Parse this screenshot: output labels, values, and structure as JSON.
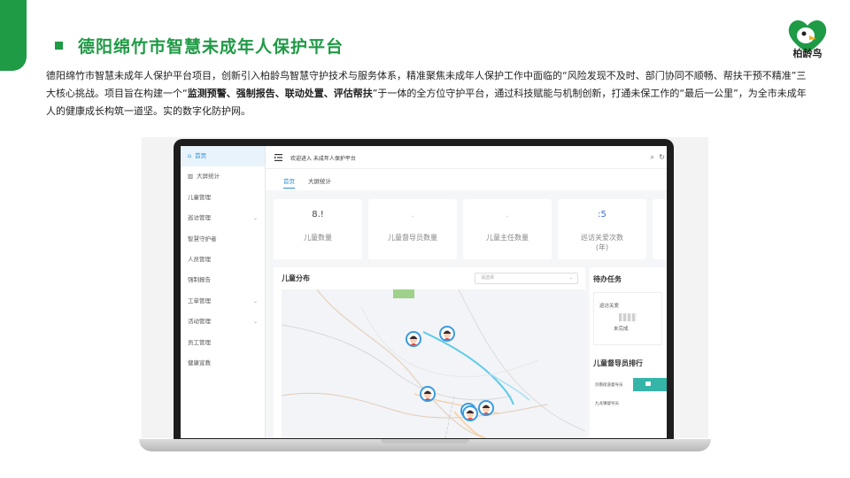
{
  "slide": {
    "title": "德阳绵竹市智慧未成年人保护平台",
    "logo_text": "柏龄鸟",
    "intro_part1": "德阳绵竹市智慧未成年人保护平台项目，创新引入柏龄鸟智慧守护技术与服务体系，精准聚焦未成年人保护工作中面临的“风险发现不及时、部门协同不顺畅、帮扶干预不精准”三大核心挑战。项目旨在构建一个“",
    "intro_bold": "监测预警、强制报告、联动处置、评估帮扶",
    "intro_part2": "”于一体的全方位守护平台，通过科技赋能与机制创新，打通未保工作的“最后一公里”，为全市未成年人的健康成长构筑一道坚。实的数字化防护网。"
  },
  "app": {
    "sidebar": [
      {
        "label": "首页",
        "icon": "home-icon",
        "active": true,
        "chevron": false
      },
      {
        "label": "大屏统计",
        "icon": "chart-icon",
        "active": false,
        "chevron": false
      },
      {
        "label": "儿童管理",
        "active": false,
        "chevron": false
      },
      {
        "label": "巡访管理",
        "active": false,
        "chevron": true
      },
      {
        "label": "智慧守护者",
        "active": false,
        "chevron": false
      },
      {
        "label": "人员管理",
        "active": false,
        "chevron": false
      },
      {
        "label": "强制报告",
        "active": false,
        "chevron": false
      },
      {
        "label": "工单管理",
        "active": false,
        "chevron": true
      },
      {
        "label": "活动管理",
        "active": false,
        "chevron": true
      },
      {
        "label": "员工管理",
        "active": false,
        "chevron": false
      },
      {
        "label": "健康宣教",
        "active": false,
        "chevron": false
      }
    ],
    "topbar_title": "欢迎进入 未成年人保护平台",
    "tabs": [
      "首页",
      "大屏统计"
    ],
    "stats": [
      {
        "value": "8.!",
        "label": "儿童数量",
        "value_color": "#444444"
      },
      {
        "value": ".",
        "label": "儿童督导员数量",
        "value_color": "#bbbbbb"
      },
      {
        "value": ".",
        "label": "儿童主任数量",
        "value_color": "#bbbbbb"
      },
      {
        "value": ":5",
        "label": "巡访关爱次数",
        "label2": "(年)",
        "value_color": "#3a6fd8"
      },
      {
        "value": "",
        "label": ""
      }
    ],
    "map_title": "儿童分布",
    "map_select_placeholder": "请选择",
    "todo_title": "待办任务",
    "todo_item": "巡访关爱",
    "todo_status": "未完成",
    "rank_title": "儿童督导员排行",
    "rank_rows": [
      "剑南街道督导员",
      "九龙镇督导员"
    ],
    "colors": {
      "brand": "#1f9a45",
      "accent": "#2b8fd6",
      "rank_bar": "#34b5a7"
    }
  }
}
